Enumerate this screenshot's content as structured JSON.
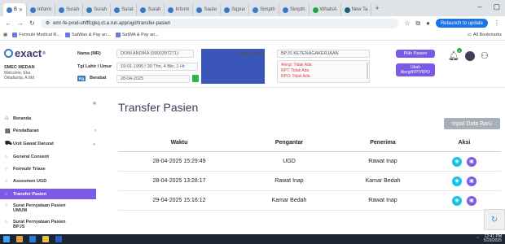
{
  "browser": {
    "tabs": [
      {
        "label": "B",
        "active": true
      },
      {
        "label": "Inform",
        "active": false
      },
      {
        "label": "Surah",
        "active": false
      },
      {
        "label": "Surah",
        "active": false
      },
      {
        "label": "Surat",
        "active": false
      },
      {
        "label": "Surah",
        "active": false
      },
      {
        "label": "Inform",
        "active": false
      },
      {
        "label": "Saute",
        "active": false
      },
      {
        "label": "Sqpuv",
        "active": false
      },
      {
        "label": "Simpth",
        "active": false
      },
      {
        "label": "Simpth",
        "active": false
      },
      {
        "label": "WhatsA",
        "active": false
      },
      {
        "label": "New Ta",
        "active": false
      }
    ],
    "new_tab_icon": "+",
    "url": "emr-fe-prod-uhfffcgkq.ct.a.run.app/ugd/transfer-pasien",
    "update_button": "Relaunch to update",
    "bookmarks": [
      {
        "label": "Formulir Medical R..."
      },
      {
        "label": "SatWan & Pay an..."
      },
      {
        "label": "SatWA & Pay an..."
      }
    ],
    "all_bookmarks": "All Bookmarks"
  },
  "header": {
    "logo_text": "exact",
    "logo_sup": "®",
    "clinic_name": "SMEC MEDAN",
    "welcome_line1": "Welcome, Eka",
    "welcome_line2": "Oktafianta, A.Md",
    "patient_name_label": "Nama (MR)",
    "patient_name_value": "DONI ANDIKA (0000397271)",
    "dob_label": "Tgl Lahir / Umur",
    "dob_value": "19-01-1995 / 30 Thn, 4 Bln, 1 Hr",
    "weight_badge": "Kg",
    "weight_label": "Berabat",
    "date_value": "28-04-2025",
    "payer_label": "Bisa Penjam",
    "payer_value": "BPJS KETENAGAKERJAAN",
    "alerts": [
      "Alergi: Tidak Ada",
      "RPT: Tidak Ada",
      "RPO: Tidak Ada"
    ],
    "pilih_pasien_button": "Pilih Pasien",
    "ubah_alergi_button_line1": "Ubah",
    "ubah_alergi_button_line2": "Alergi/RPT/RPO",
    "notif_count": "0"
  },
  "sidebar": {
    "collapse_icon": "«",
    "items": [
      {
        "label": "Beranda",
        "icon": "home-icon",
        "glyph": "⌂"
      },
      {
        "label": "Pendaftaran",
        "icon": "clipboard-icon",
        "glyph": "▤",
        "chev": "›"
      },
      {
        "label": "Unit Gawat Darurat",
        "icon": "ambulance-icon",
        "glyph": "⛟",
        "chev": "⌄"
      },
      {
        "label": "General Consent",
        "glyph": "○"
      },
      {
        "label": "Formulir Triase",
        "glyph": "○"
      },
      {
        "label": "Assesmen UGD",
        "glyph": "○"
      },
      {
        "label": "Transfer Pasien",
        "glyph": "○"
      },
      {
        "label": "Surat Pernyataan Pasien",
        "label2": "UMUM",
        "glyph": "○"
      },
      {
        "label": "Surat Pernyataan Pasien",
        "label2": "BPJS",
        "glyph": "○"
      }
    ]
  },
  "main": {
    "title": "Transfer Pasien",
    "input_button": "Input Data Baru",
    "columns": [
      "Waktu",
      "Pengantar",
      "Penerima",
      "Aksi"
    ],
    "rows": [
      {
        "waktu": "28-04-2025 15:29:49",
        "pengantar": "UGD",
        "penerima": "Rawat Inap"
      },
      {
        "waktu": "28-04-2025 13:28:17",
        "pengantar": "Rawat Inap",
        "penerima": "Kamar Bedah"
      },
      {
        "waktu": "29-04-2025 15:16:12",
        "pengantar": "Kamar Bedah",
        "penerima": "Rawat Inap"
      }
    ],
    "view_icon_glyph": "◉",
    "doc_icon_glyph": "▣"
  },
  "taskbar": {
    "time": "12:41 PM",
    "date": "5/29/2025"
  },
  "colors": {
    "accent": "#7b5be6",
    "info": "#17c3e6",
    "alert_text": "#e0383e",
    "redaction": "#3a56b8"
  }
}
